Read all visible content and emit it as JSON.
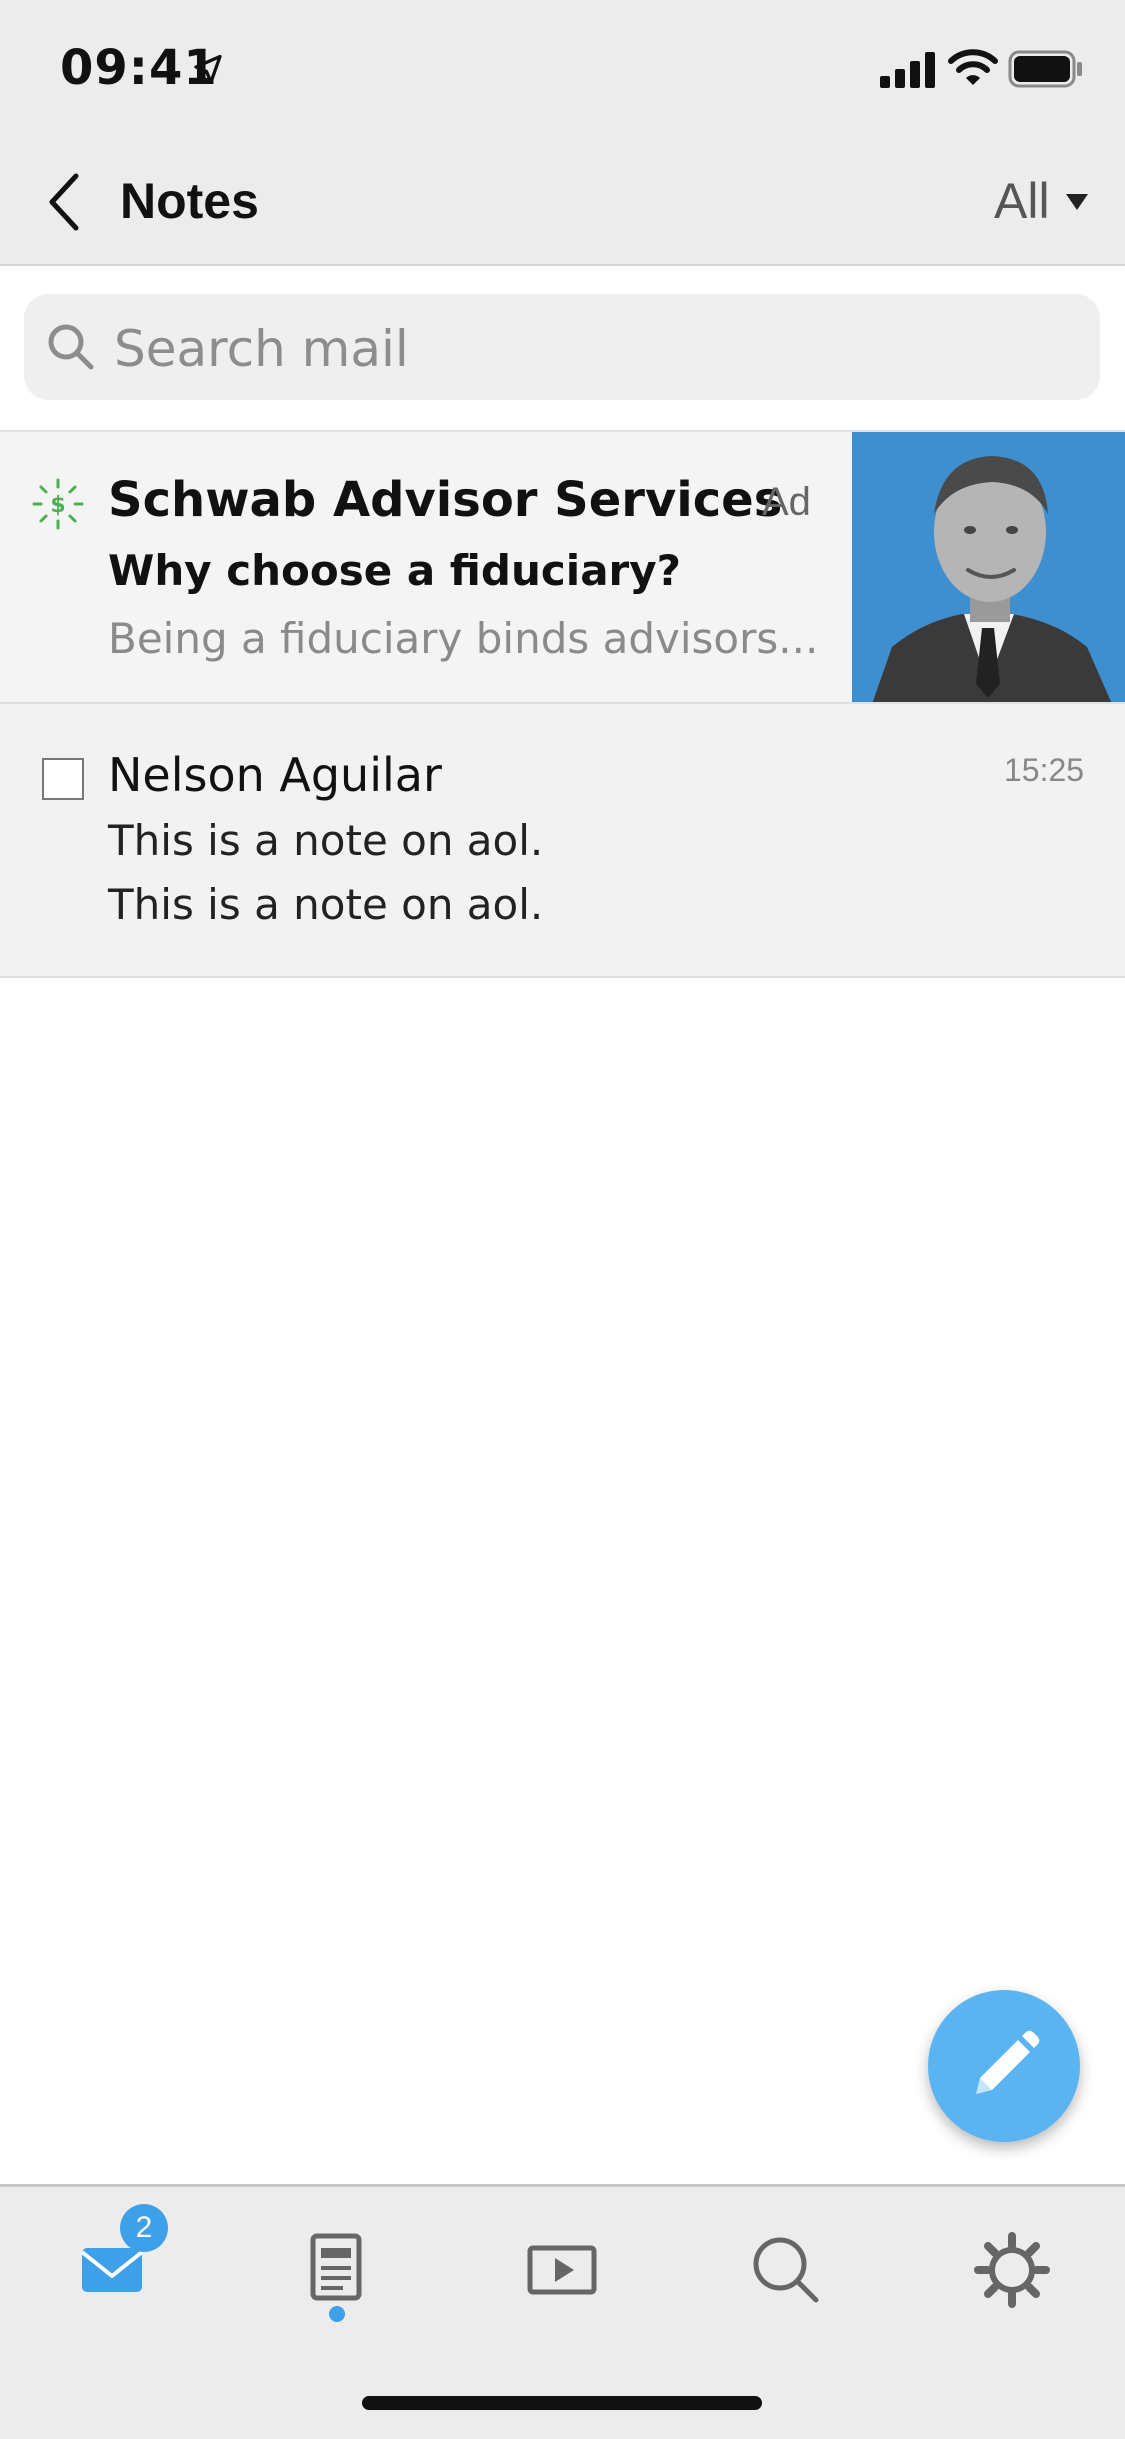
{
  "status_bar": {
    "time": "09:41",
    "icons": [
      "location-arrow-icon",
      "cellular-signal-icon",
      "wifi-icon",
      "battery-icon"
    ]
  },
  "nav": {
    "back_icon": "chevron-left-icon",
    "title": "Notes",
    "filter_label": "All",
    "filter_icon": "caret-down-icon"
  },
  "search": {
    "placeholder": "Search mail",
    "icon": "search-icon"
  },
  "ad": {
    "sender": "Schwab Advisor Services",
    "label": "Ad",
    "subject": "Why choose a fiduciary?",
    "preview": "Being a fiduciary binds advisors...",
    "icon": "sponsor-dollar-icon"
  },
  "notes": [
    {
      "sender": "Nelson Aguilar",
      "time": "15:25",
      "line1": "This is a note on aol.",
      "line2": "This is a note on aol."
    }
  ],
  "tabs": {
    "mail_badge": "2",
    "items": [
      "mail-icon",
      "notes-icon",
      "video-icon",
      "search-icon",
      "settings-icon"
    ],
    "active": "notes"
  },
  "colors": {
    "accent": "#3fa0ea",
    "fab": "#5ab4f2",
    "bar_background": "#ececec",
    "ad_photo_background": "#3d8fd0"
  }
}
